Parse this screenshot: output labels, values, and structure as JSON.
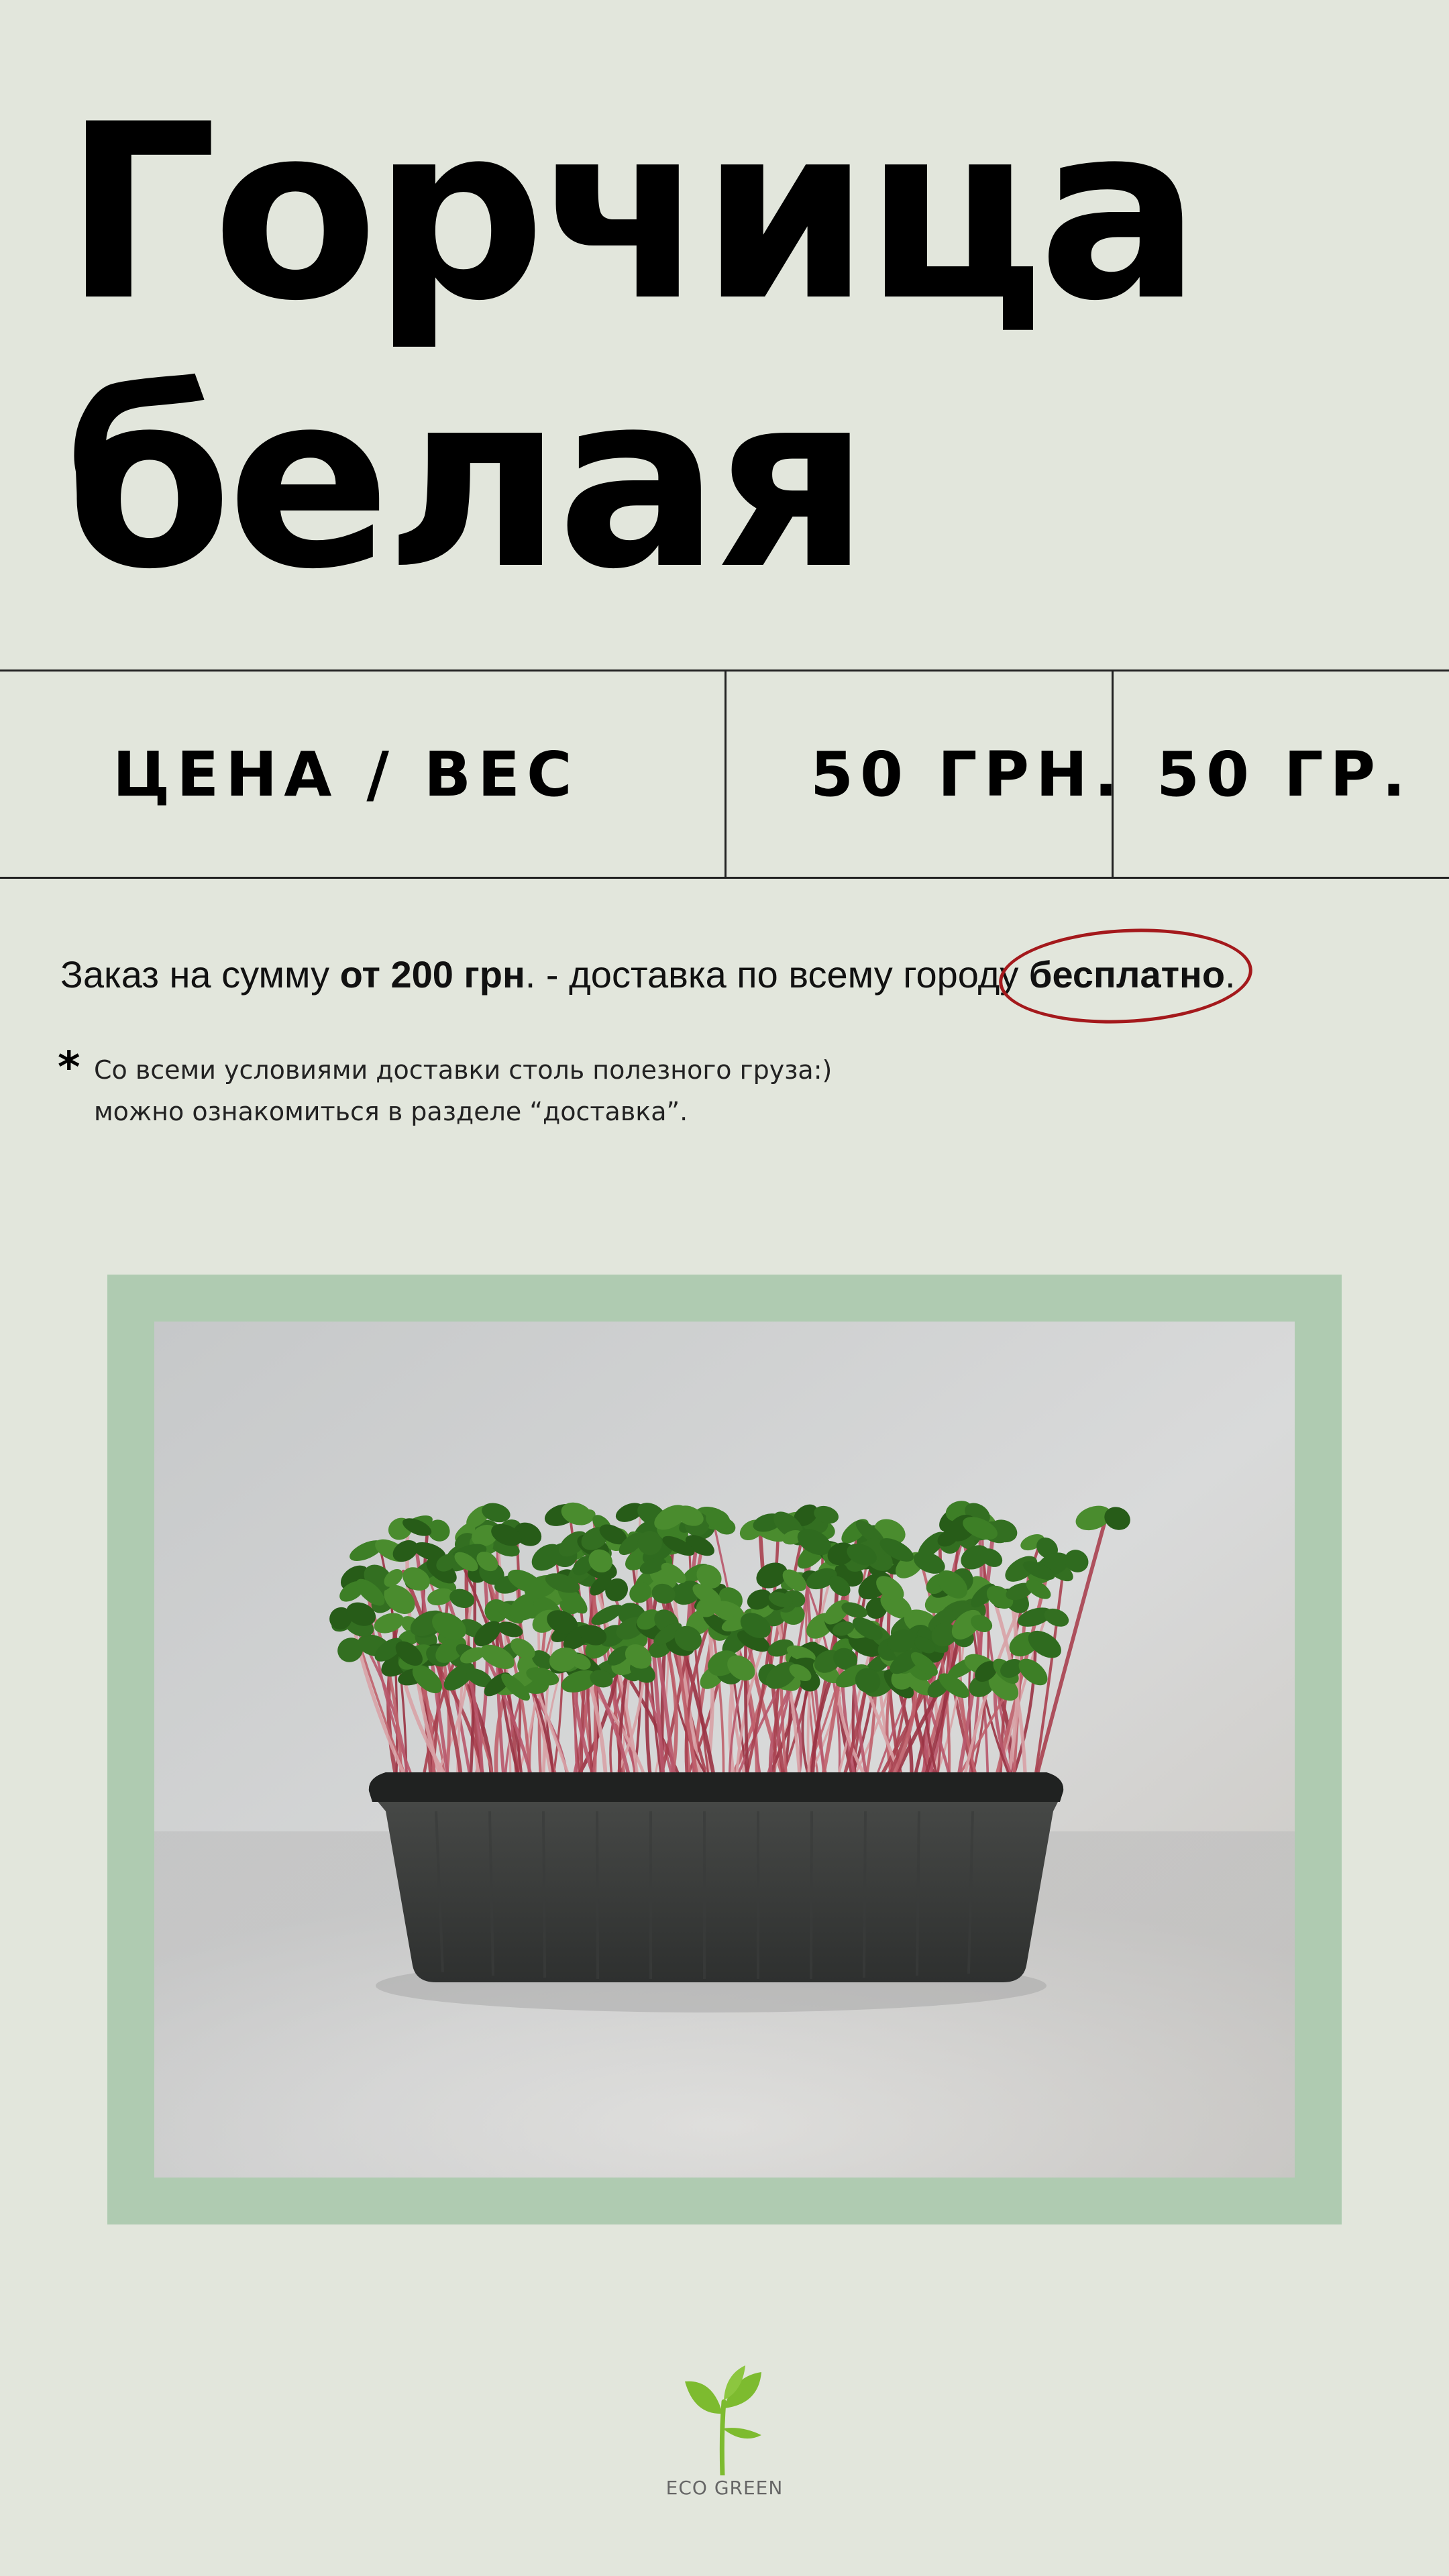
{
  "title": {
    "line1": "Горчица",
    "line2": "белая"
  },
  "price_table": {
    "label": "ЦЕНА / ВЕС",
    "price": "50 ГРН.",
    "weight": "50 ГР."
  },
  "delivery": {
    "prefix": "Заказ на сумму ",
    "amount": "от 200 грн",
    "middle": ". - доставка по всему городу ",
    "free": "бесплатно",
    "suffix": "."
  },
  "note": {
    "star": "*",
    "line1": "Со всеми условиями доставки столь полезного груза:)",
    "line2": "можно ознакомиться в разделе “доставка”."
  },
  "photo": {
    "subject": "microgreens in black plastic tray"
  },
  "logo": {
    "text": "ECO GREEN",
    "icon": "sprout-icon",
    "color": "#7dbb2f"
  },
  "colors": {
    "background": "#e2e6dc",
    "frame": "#afcbb1",
    "accent_ellipse": "#a4191c"
  }
}
